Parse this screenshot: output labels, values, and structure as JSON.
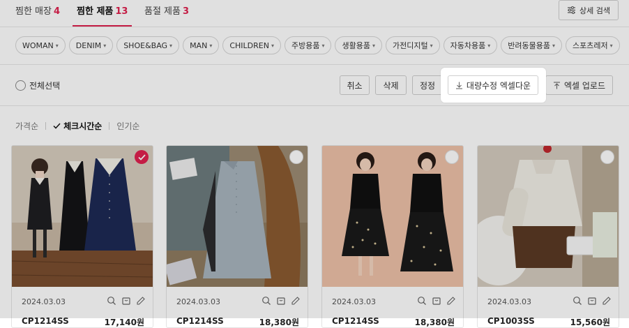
{
  "tabs": [
    {
      "label": "찜한 매장",
      "count": "4"
    },
    {
      "label": "찜한 제품",
      "count": "13"
    },
    {
      "label": "품절 제품",
      "count": "3"
    }
  ],
  "detail_search_label": "상세 검색",
  "categories": [
    "WOMAN",
    "DENIM",
    "SHOE&BAG",
    "MAN",
    "CHILDREN",
    "주방용품",
    "생활용품",
    "가전디지털",
    "자동차용품",
    "반려동물용품",
    "스포츠레저"
  ],
  "select_all_label": "전체선택",
  "actions": {
    "cancel": "취소",
    "delete": "삭제",
    "edit": "정정",
    "bulk_excel_download": "대량수정 엑셀다운",
    "excel_upload": "엑셀 업로드"
  },
  "sort": {
    "price": "가격순",
    "check_time": "체크시간순",
    "popular": "인기순"
  },
  "products": [
    {
      "date": "2024.03.03",
      "code": "CP1214SS",
      "price": "17,140원",
      "checked": true
    },
    {
      "date": "2024.03.03",
      "code": "CP1214SS",
      "price": "18,380원",
      "checked": false
    },
    {
      "date": "2024.03.03",
      "code": "CP1214SS",
      "price": "18,380원",
      "checked": false
    },
    {
      "date": "2024.03.03",
      "code": "CP1003SS",
      "price": "15,560원",
      "checked": false
    }
  ],
  "colors": {
    "accent": "#e0224f"
  }
}
